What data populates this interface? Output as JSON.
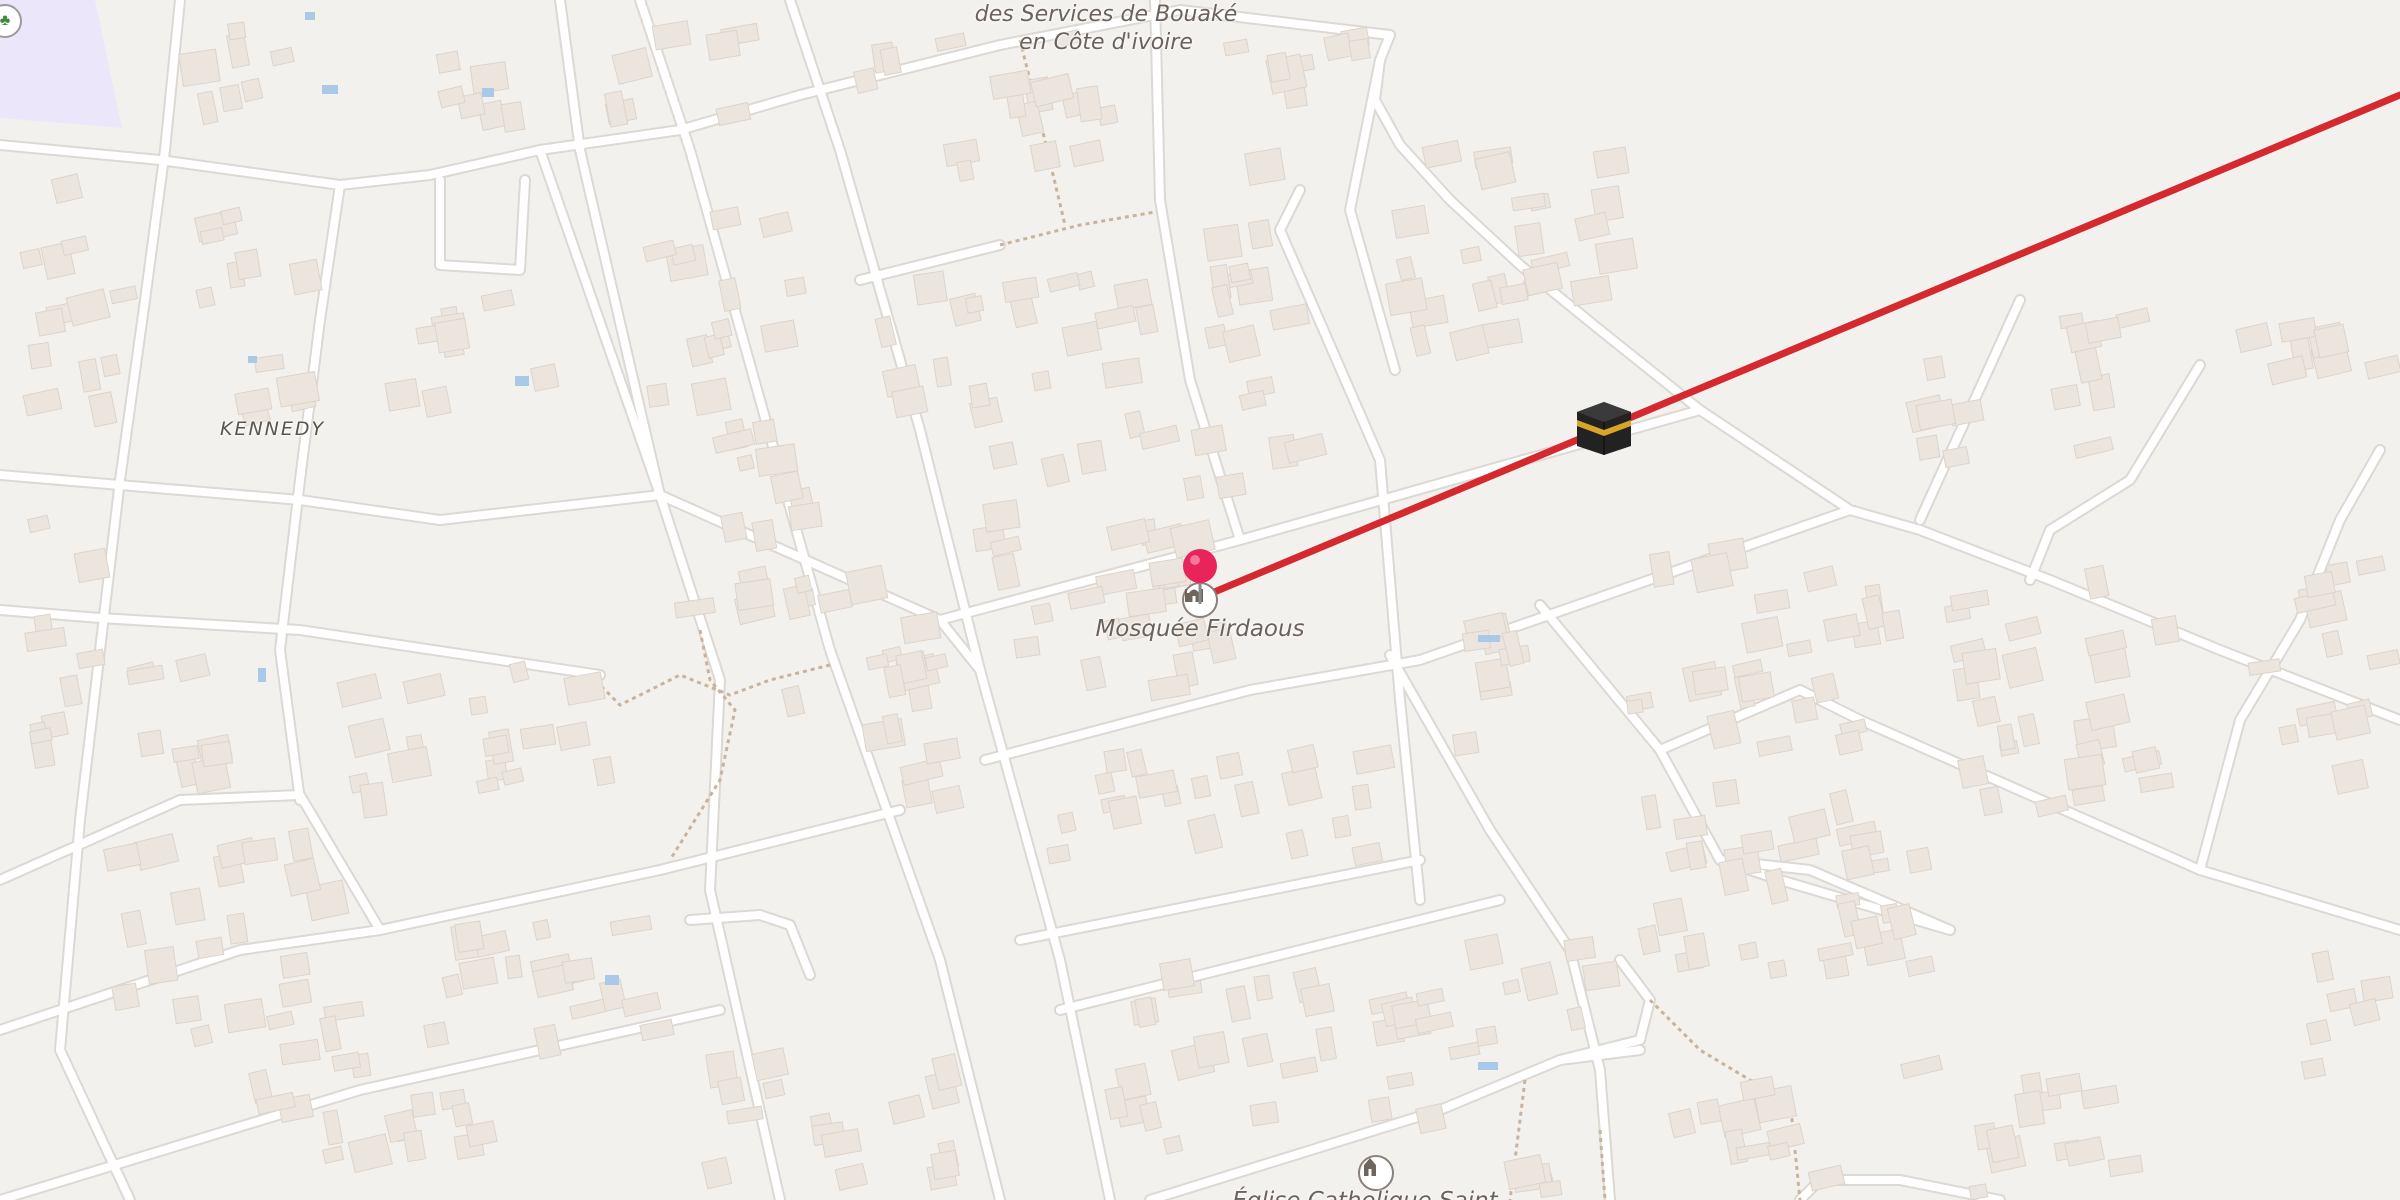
{
  "map": {
    "labels": {
      "services_line1": "des Services de Bouaké",
      "services_line2": "en Côte d'ivoire",
      "kennedy": "KENNEDY",
      "mosque": "Mosquée Firdaous",
      "church": "Église Catholique Saint..."
    },
    "icons": {
      "pin": "location-pin-icon",
      "kaaba": "kaaba-icon",
      "mosque": "mosque-icon",
      "church": "church-icon",
      "corner": "park-icon"
    },
    "colors": {
      "background": "#f3f1ee",
      "road": "#ffffff",
      "road_casing": "#dcd8d3",
      "building": "#ebe5de",
      "building_edge": "#dcd4cb",
      "path": "#c9b39a",
      "qibla_line": "#d4292e",
      "pin": "#e8245a",
      "water": "#a9c9e6",
      "park": "#ebe6fa"
    }
  }
}
